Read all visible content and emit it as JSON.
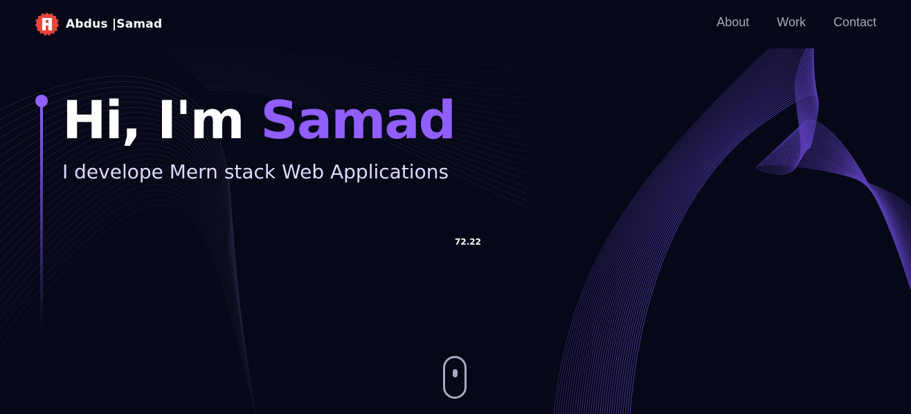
{
  "nav": {
    "logo_first": "Abdus",
    "logo_second": " |Samad",
    "links": [
      {
        "label": "About"
      },
      {
        "label": "Work"
      },
      {
        "label": "Contact"
      }
    ]
  },
  "hero": {
    "title_prefix": "Hi, I'm ",
    "title_name": "Samad",
    "subtitle": "I develope Mern stack Web Applications",
    "fps_value": "72.22"
  },
  "colors": {
    "background": "#050816",
    "accent": "#915eff",
    "nav_text": "#aaa6c3",
    "logo_red": "#e8453c"
  },
  "icons": {
    "logo": "logo-icon",
    "scroll": "mouse-scroll-icon"
  }
}
